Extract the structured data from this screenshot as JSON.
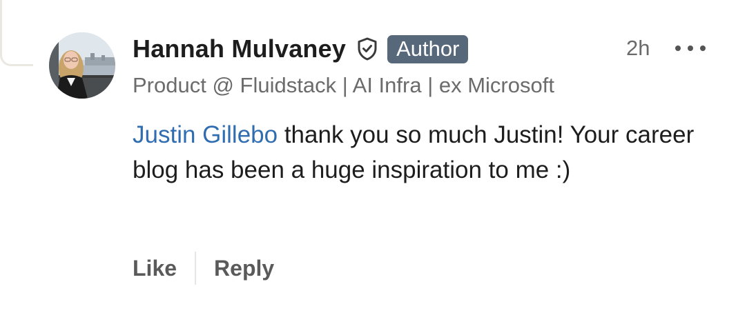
{
  "comment": {
    "author": {
      "name": "Hannah Mulvaney",
      "badge": "Author",
      "headline": "Product @ Fluidstack | AI Infra | ex Microsoft",
      "verified_icon": "shield-check-icon"
    },
    "timestamp": "2h",
    "more_icon": "ellipsis-icon",
    "mention": "Justin Gillebo",
    "text": " thank you so much Justin! Your career blog has been a huge inspiration to me :)",
    "actions": {
      "like_label": "Like",
      "reply_label": "Reply"
    }
  },
  "colors": {
    "badge_bg": "#56687a",
    "mention": "#2f6db0",
    "text": "#1d1d1d",
    "muted": "#6b6b6b"
  }
}
